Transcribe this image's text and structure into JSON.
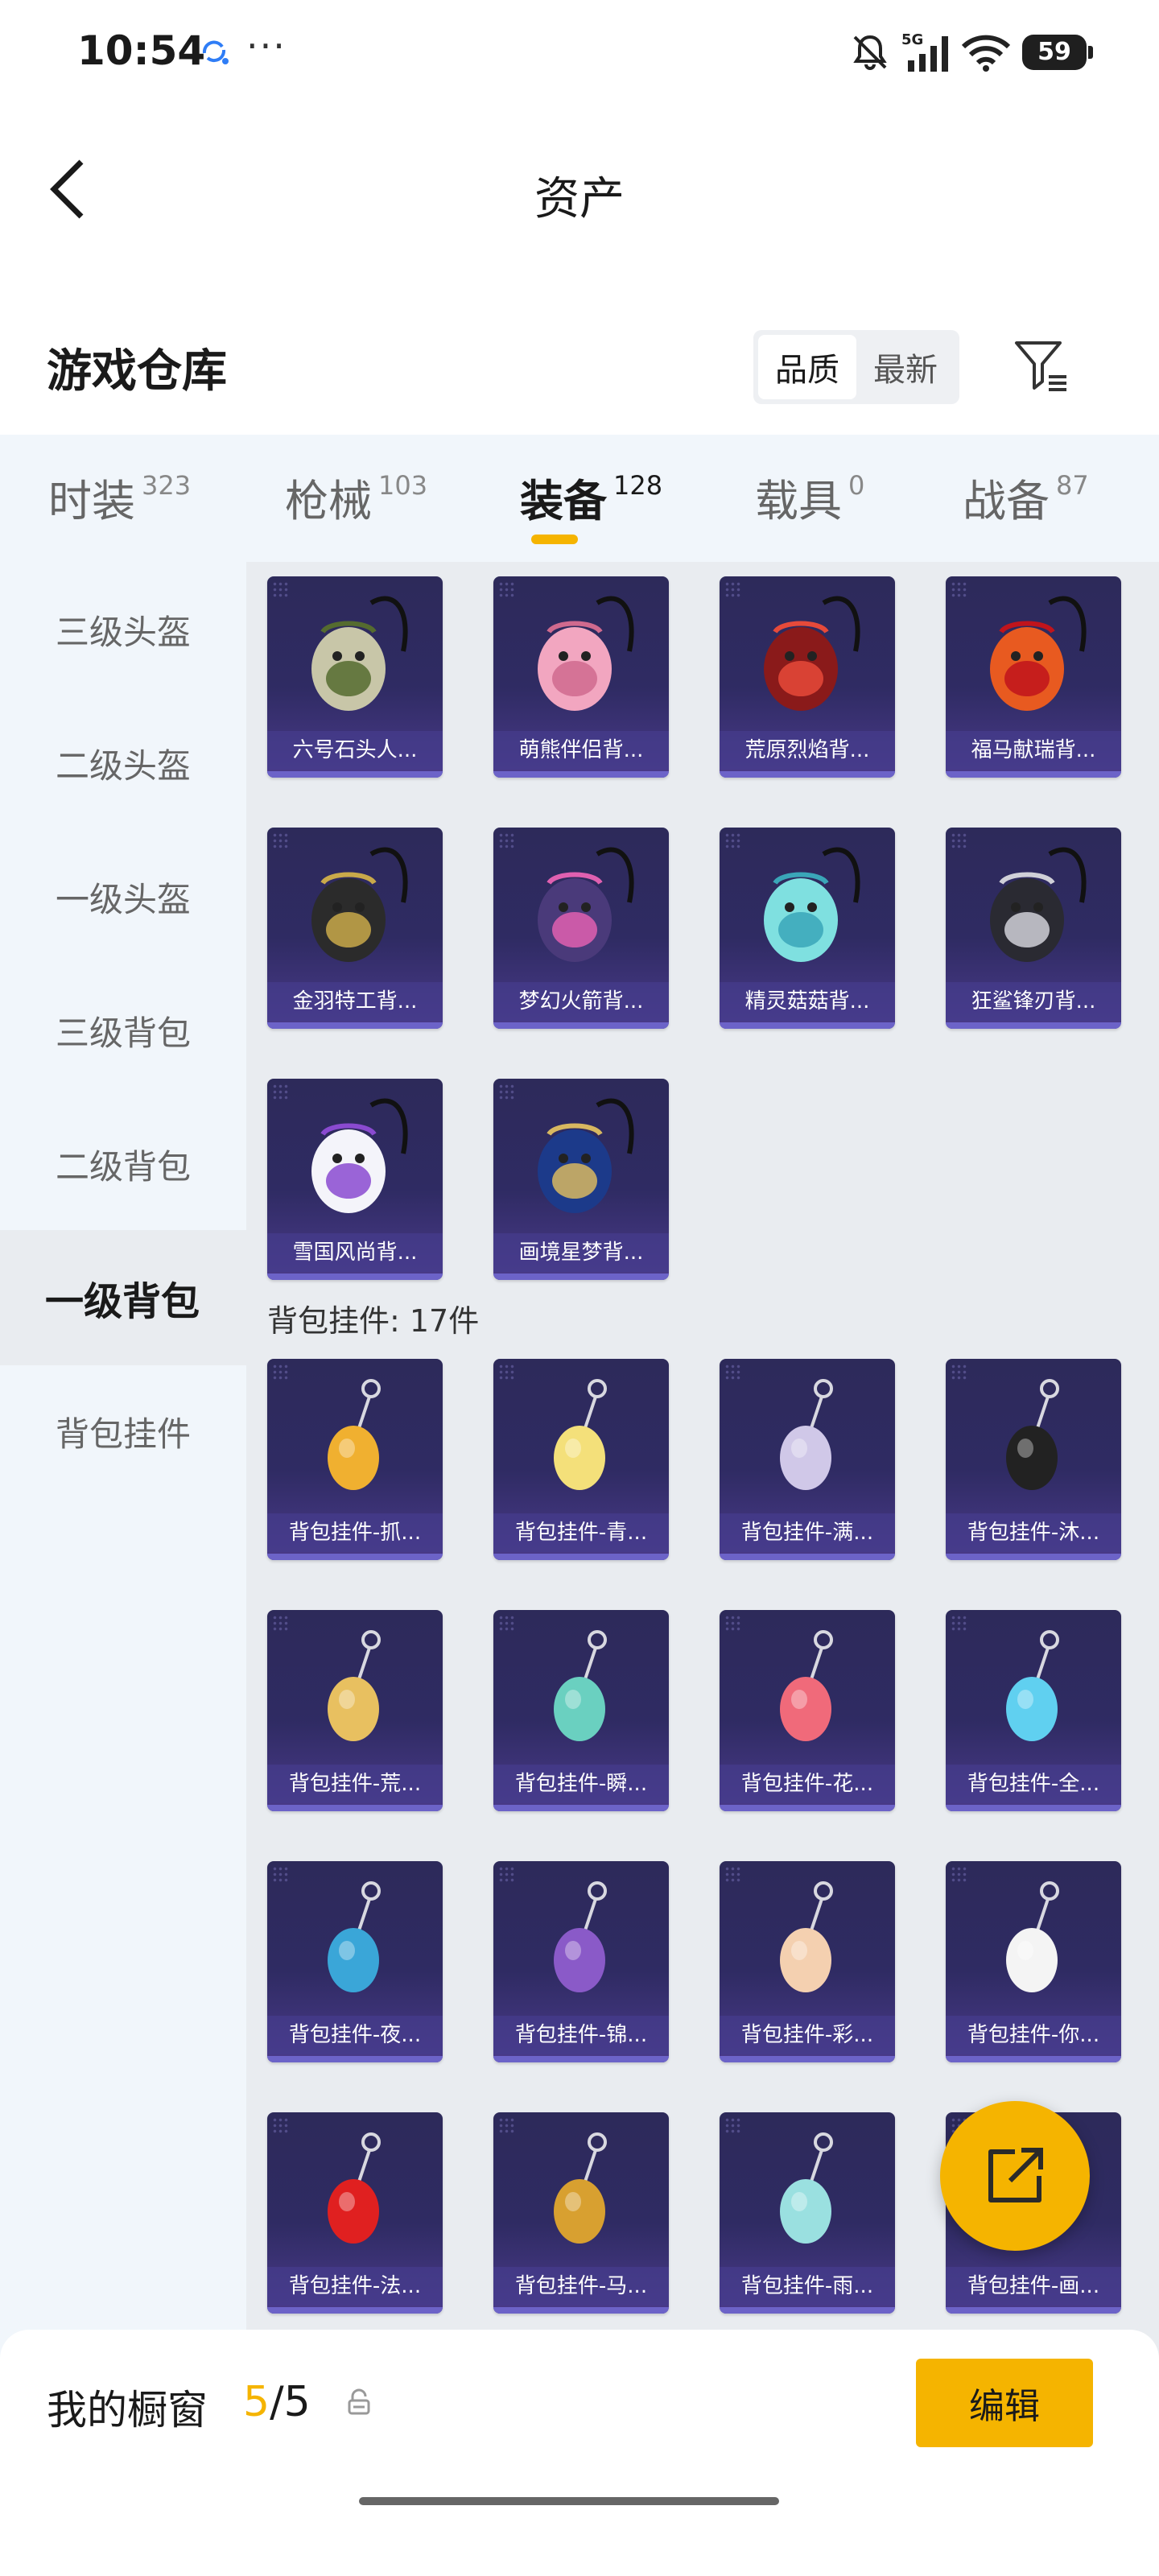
{
  "status_bar": {
    "time": "10:54",
    "battery": "59",
    "network": "5G"
  },
  "nav": {
    "title": "资产"
  },
  "header": {
    "title": "游戏仓库",
    "sort_quality": "品质",
    "sort_newest": "最新"
  },
  "tabs": [
    {
      "label": "时装",
      "count": "323"
    },
    {
      "label": "枪械",
      "count": "103"
    },
    {
      "label": "装备",
      "count": "128"
    },
    {
      "label": "载具",
      "count": "0"
    },
    {
      "label": "战备",
      "count": "87"
    }
  ],
  "sidebar": {
    "items": [
      "三级头盔",
      "二级头盔",
      "一级头盔",
      "三级背包",
      "二级背包",
      "一级背包",
      "背包挂件"
    ]
  },
  "backpacks": [
    {
      "label": "六号石头人...",
      "icon": "stone-backpack-icon"
    },
    {
      "label": "萌熊伴侣背...",
      "icon": "bear-backpack-icon"
    },
    {
      "label": "荒原烈焰背...",
      "icon": "flame-backpack-icon"
    },
    {
      "label": "福马献瑞背...",
      "icon": "horse-backpack-icon"
    },
    {
      "label": "金羽特工背...",
      "icon": "agent-backpack-icon"
    },
    {
      "label": "梦幻火箭背...",
      "icon": "rocket-backpack-icon"
    },
    {
      "label": "精灵菇菇背...",
      "icon": "mushroom-backpack-icon"
    },
    {
      "label": "狂鲨锋刃背...",
      "icon": "shark-backpack-icon"
    },
    {
      "label": "雪国风尚背...",
      "icon": "bunny-backpack-icon"
    },
    {
      "label": "画境星梦背...",
      "icon": "book-backpack-icon"
    }
  ],
  "pendants_section": {
    "title": "背包挂件: 17件"
  },
  "pendants": [
    {
      "label": "背包挂件-抓...",
      "icon": "anchor-pendant-icon"
    },
    {
      "label": "背包挂件-青...",
      "icon": "pear-pendant-icon"
    },
    {
      "label": "背包挂件-满...",
      "icon": "moon-pendant-icon"
    },
    {
      "label": "背包挂件-沐...",
      "icon": "cat-pendant-icon"
    },
    {
      "label": "背包挂件-荒...",
      "icon": "sun-pendant-icon"
    },
    {
      "label": "背包挂件-瞬...",
      "icon": "blade-pendant-icon"
    },
    {
      "label": "背包挂件-花...",
      "icon": "charm-pendant-icon"
    },
    {
      "label": "背包挂件-全...",
      "icon": "cyber-pendant-icon"
    },
    {
      "label": "背包挂件-夜...",
      "icon": "beetle-pendant-icon"
    },
    {
      "label": "背包挂件-锦...",
      "icon": "brush-pendant-icon"
    },
    {
      "label": "背包挂件-彩...",
      "icon": "icecream-pendant-icon"
    },
    {
      "label": "背包挂件-你...",
      "icon": "penguin-pendant-icon"
    },
    {
      "label": "背包挂件-法...",
      "icon": "shield-pendant-icon"
    },
    {
      "label": "背包挂件-马...",
      "icon": "rockinghorse-pendant-icon"
    },
    {
      "label": "背包挂件-雨...",
      "icon": "umbrella-pendant-icon"
    },
    {
      "label": "背包挂件-画...",
      "icon": "scroll-pendant-icon"
    }
  ],
  "showcase": {
    "label": "我的橱窗",
    "current": "5",
    "separator": "/",
    "total": "5",
    "edit_label": "编辑"
  },
  "colors": {
    "accent": "#f5b400",
    "card_bg": "#2f2b63",
    "card_label": "#4a3f8c",
    "sidebar_bg": "#f1f6fb",
    "content_bg": "#e9ecf0"
  }
}
